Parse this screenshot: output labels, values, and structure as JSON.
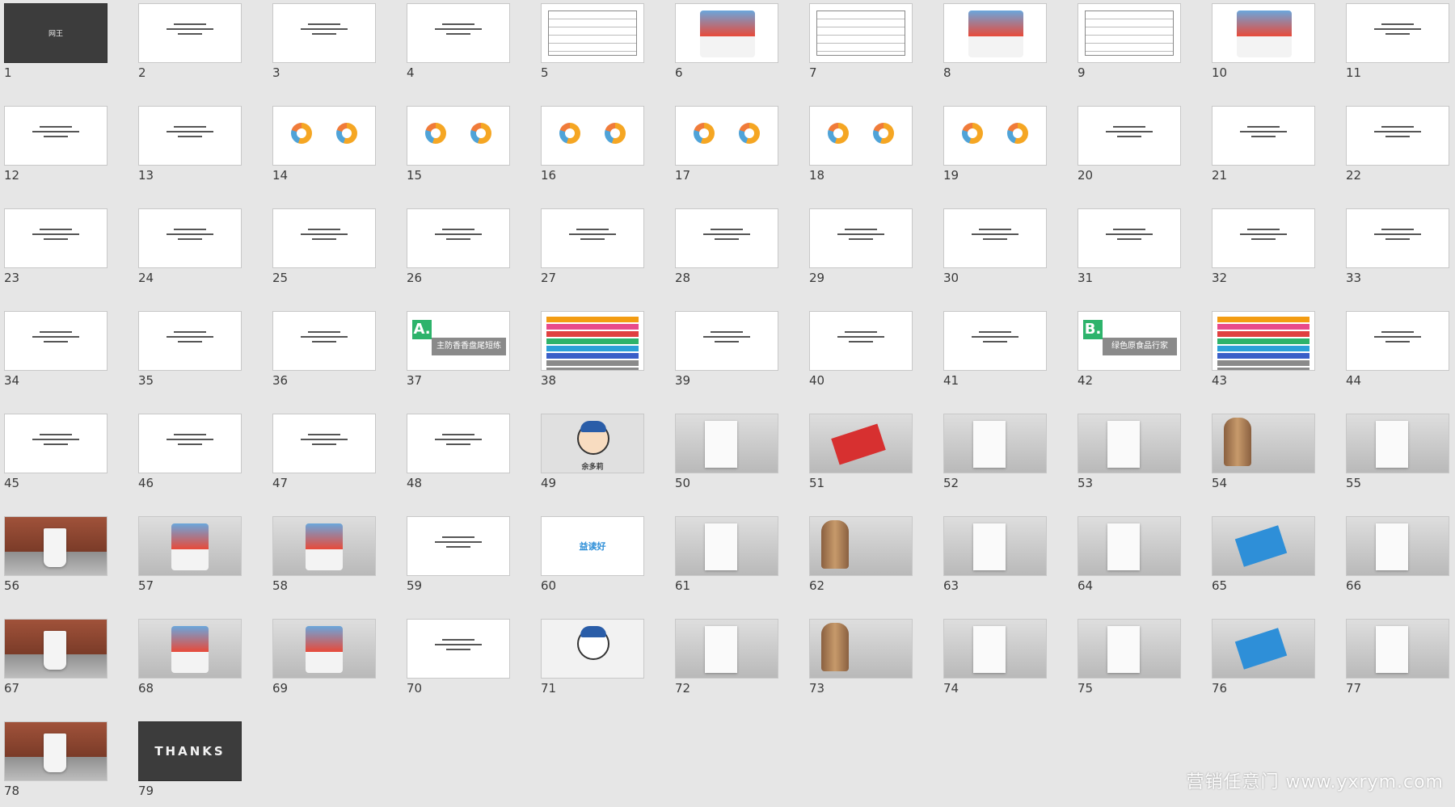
{
  "watermark": "营销任意门 www.yxrym.com",
  "slides": [
    {
      "n": "1",
      "kind": "dark-logo",
      "text": "网王"
    },
    {
      "n": "2",
      "kind": "text"
    },
    {
      "n": "3",
      "kind": "text"
    },
    {
      "n": "4",
      "kind": "text"
    },
    {
      "n": "5",
      "kind": "table"
    },
    {
      "n": "6",
      "kind": "product"
    },
    {
      "n": "7",
      "kind": "table"
    },
    {
      "n": "8",
      "kind": "product"
    },
    {
      "n": "9",
      "kind": "table"
    },
    {
      "n": "10",
      "kind": "product"
    },
    {
      "n": "11",
      "kind": "text"
    },
    {
      "n": "12",
      "kind": "text"
    },
    {
      "n": "13",
      "kind": "text"
    },
    {
      "n": "14",
      "kind": "donut"
    },
    {
      "n": "15",
      "kind": "donut"
    },
    {
      "n": "16",
      "kind": "donut"
    },
    {
      "n": "17",
      "kind": "donut"
    },
    {
      "n": "18",
      "kind": "donut"
    },
    {
      "n": "19",
      "kind": "donut"
    },
    {
      "n": "20",
      "kind": "text"
    },
    {
      "n": "21",
      "kind": "text"
    },
    {
      "n": "22",
      "kind": "text"
    },
    {
      "n": "23",
      "kind": "text"
    },
    {
      "n": "24",
      "kind": "text"
    },
    {
      "n": "25",
      "kind": "text"
    },
    {
      "n": "26",
      "kind": "text"
    },
    {
      "n": "27",
      "kind": "text"
    },
    {
      "n": "28",
      "kind": "text"
    },
    {
      "n": "29",
      "kind": "text"
    },
    {
      "n": "30",
      "kind": "text"
    },
    {
      "n": "31",
      "kind": "text"
    },
    {
      "n": "32",
      "kind": "text"
    },
    {
      "n": "33",
      "kind": "text"
    },
    {
      "n": "34",
      "kind": "text"
    },
    {
      "n": "35",
      "kind": "text"
    },
    {
      "n": "36",
      "kind": "text"
    },
    {
      "n": "37",
      "kind": "section",
      "tag": "A.",
      "text": "主防香香盘尾短练"
    },
    {
      "n": "38",
      "kind": "bars"
    },
    {
      "n": "39",
      "kind": "text"
    },
    {
      "n": "40",
      "kind": "text"
    },
    {
      "n": "41",
      "kind": "text"
    },
    {
      "n": "42",
      "kind": "section",
      "tag": "B.",
      "text": "绿色原食品行家"
    },
    {
      "n": "43",
      "kind": "bars"
    },
    {
      "n": "44",
      "kind": "text"
    },
    {
      "n": "45",
      "kind": "text"
    },
    {
      "n": "46",
      "kind": "text"
    },
    {
      "n": "47",
      "kind": "text"
    },
    {
      "n": "48",
      "kind": "text"
    },
    {
      "n": "49",
      "kind": "mascot",
      "text": "余多莉"
    },
    {
      "n": "50",
      "kind": "mockup"
    },
    {
      "n": "51",
      "kind": "card-red"
    },
    {
      "n": "52",
      "kind": "mockup"
    },
    {
      "n": "53",
      "kind": "mockup"
    },
    {
      "n": "54",
      "kind": "stamp"
    },
    {
      "n": "55",
      "kind": "mockup"
    },
    {
      "n": "56",
      "kind": "cup"
    },
    {
      "n": "57",
      "kind": "pack"
    },
    {
      "n": "58",
      "kind": "pack"
    },
    {
      "n": "59",
      "kind": "text"
    },
    {
      "n": "60",
      "kind": "brand",
      "text": "益读好"
    },
    {
      "n": "61",
      "kind": "mockup"
    },
    {
      "n": "62",
      "kind": "stamp"
    },
    {
      "n": "63",
      "kind": "mockup"
    },
    {
      "n": "64",
      "kind": "mockup"
    },
    {
      "n": "65",
      "kind": "card-blue"
    },
    {
      "n": "66",
      "kind": "mockup"
    },
    {
      "n": "67",
      "kind": "cup"
    },
    {
      "n": "68",
      "kind": "pack"
    },
    {
      "n": "69",
      "kind": "pack"
    },
    {
      "n": "70",
      "kind": "text"
    },
    {
      "n": "71",
      "kind": "mascot2"
    },
    {
      "n": "72",
      "kind": "mockup"
    },
    {
      "n": "73",
      "kind": "stamp"
    },
    {
      "n": "74",
      "kind": "mockup"
    },
    {
      "n": "75",
      "kind": "mockup"
    },
    {
      "n": "76",
      "kind": "card-blue"
    },
    {
      "n": "77",
      "kind": "mockup"
    },
    {
      "n": "78",
      "kind": "cup"
    },
    {
      "n": "79",
      "kind": "dark-thanks",
      "text": "THANKS"
    }
  ]
}
